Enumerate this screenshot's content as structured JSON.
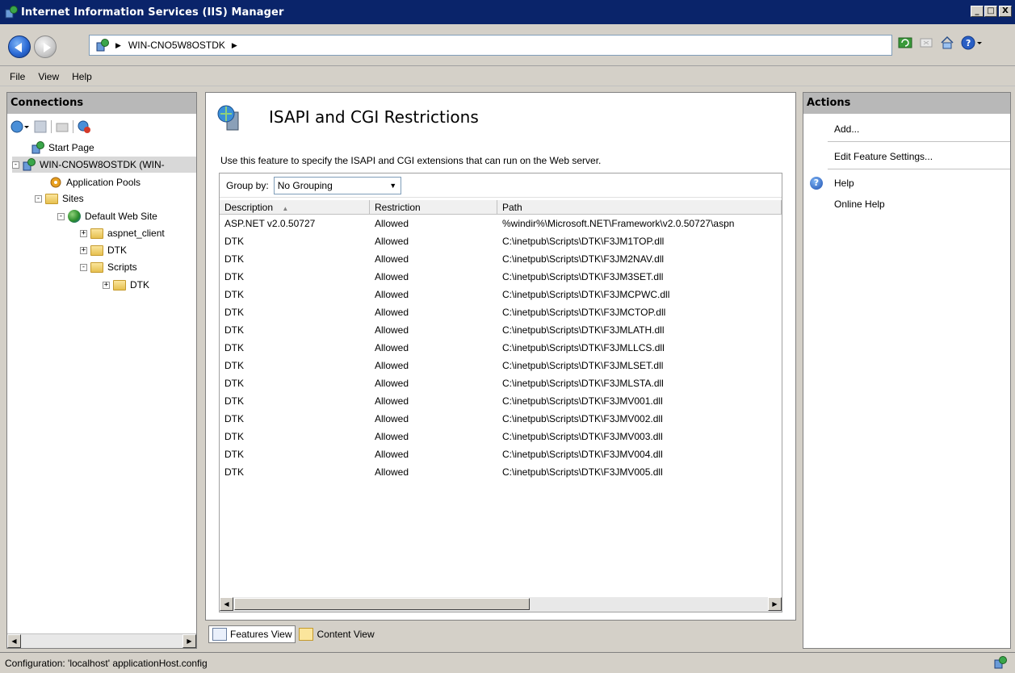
{
  "window": {
    "title": "Internet Information Services (IIS) Manager",
    "min_label": "_",
    "max_label": "□",
    "close_label": "X"
  },
  "address": {
    "path": "WIN-CNO5W8OSTDK",
    "sep": "▶"
  },
  "menu": {
    "file": "File",
    "view": "View",
    "help": "Help"
  },
  "connections": {
    "title": "Connections",
    "tree": {
      "start_page": "Start Page",
      "server": "WIN-CNO5W8OSTDK (WIN-",
      "app_pools": "Application Pools",
      "sites": "Sites",
      "default_site": "Default Web Site",
      "aspnet_client": "aspnet_client",
      "dtk": "DTK",
      "scripts": "Scripts",
      "scripts_dtk": "DTK"
    }
  },
  "feature": {
    "title": "ISAPI and CGI Restrictions",
    "description": "Use this feature to specify the ISAPI and CGI extensions that can run on the Web server.",
    "group_by_label": "Group by:",
    "group_by_value": "No Grouping",
    "columns": {
      "description": "Description",
      "sort_glyph": "▲",
      "restriction": "Restriction",
      "path": "Path"
    },
    "rows": [
      {
        "description": "ASP.NET v2.0.50727",
        "restriction": "Allowed",
        "path": "%windir%\\Microsoft.NET\\Framework\\v2.0.50727\\aspn"
      },
      {
        "description": "DTK",
        "restriction": "Allowed",
        "path": "C:\\inetpub\\Scripts\\DTK\\F3JM1TOP.dll"
      },
      {
        "description": "DTK",
        "restriction": "Allowed",
        "path": "C:\\inetpub\\Scripts\\DTK\\F3JM2NAV.dll"
      },
      {
        "description": "DTK",
        "restriction": "Allowed",
        "path": "C:\\inetpub\\Scripts\\DTK\\F3JM3SET.dll"
      },
      {
        "description": "DTK",
        "restriction": "Allowed",
        "path": "C:\\inetpub\\Scripts\\DTK\\F3JMCPWC.dll"
      },
      {
        "description": "DTK",
        "restriction": "Allowed",
        "path": "C:\\inetpub\\Scripts\\DTK\\F3JMCTOP.dll"
      },
      {
        "description": "DTK",
        "restriction": "Allowed",
        "path": "C:\\inetpub\\Scripts\\DTK\\F3JMLATH.dll"
      },
      {
        "description": "DTK",
        "restriction": "Allowed",
        "path": "C:\\inetpub\\Scripts\\DTK\\F3JMLLCS.dll"
      },
      {
        "description": "DTK",
        "restriction": "Allowed",
        "path": "C:\\inetpub\\Scripts\\DTK\\F3JMLSET.dll"
      },
      {
        "description": "DTK",
        "restriction": "Allowed",
        "path": "C:\\inetpub\\Scripts\\DTK\\F3JMLSTA.dll"
      },
      {
        "description": "DTK",
        "restriction": "Allowed",
        "path": "C:\\inetpub\\Scripts\\DTK\\F3JMV001.dll"
      },
      {
        "description": "DTK",
        "restriction": "Allowed",
        "path": "C:\\inetpub\\Scripts\\DTK\\F3JMV002.dll"
      },
      {
        "description": "DTK",
        "restriction": "Allowed",
        "path": "C:\\inetpub\\Scripts\\DTK\\F3JMV003.dll"
      },
      {
        "description": "DTK",
        "restriction": "Allowed",
        "path": "C:\\inetpub\\Scripts\\DTK\\F3JMV004.dll"
      },
      {
        "description": "DTK",
        "restriction": "Allowed",
        "path": "C:\\inetpub\\Scripts\\DTK\\F3JMV005.dll"
      }
    ]
  },
  "view_tabs": {
    "features": "Features View",
    "content": "Content View"
  },
  "actions": {
    "title": "Actions",
    "add": "Add...",
    "edit_settings": "Edit Feature Settings...",
    "help": "Help",
    "online_help": "Online Help"
  },
  "status": {
    "text": "Configuration: 'localhost' applicationHost.config"
  },
  "colors": {
    "title_bar": "#0a246a",
    "chrome": "#d4d0c8",
    "pane_header": "#b8b8b8"
  }
}
